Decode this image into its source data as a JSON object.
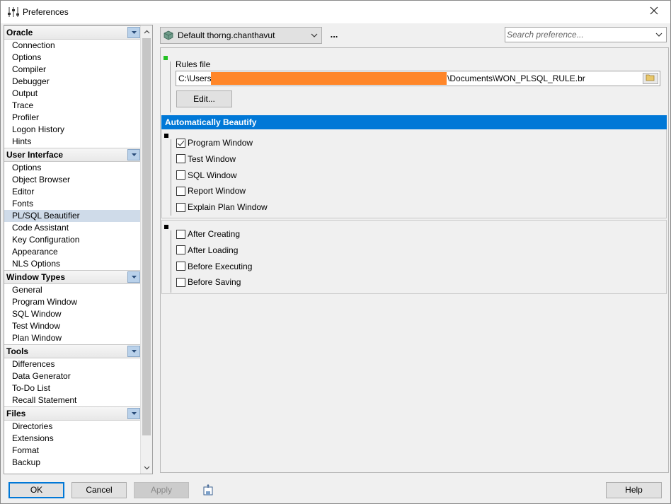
{
  "window": {
    "title": "Preferences"
  },
  "tree": {
    "groups": [
      {
        "label": "Oracle",
        "items": [
          "Connection",
          "Options",
          "Compiler",
          "Debugger",
          "Output",
          "Trace",
          "Profiler",
          "Logon History",
          "Hints"
        ]
      },
      {
        "label": "User Interface",
        "items": [
          "Options",
          "Object Browser",
          "Editor",
          "Fonts",
          "PL/SQL Beautifier",
          "Code Assistant",
          "Key Configuration",
          "Appearance",
          "NLS Options"
        ]
      },
      {
        "label": "Window Types",
        "items": [
          "General",
          "Program Window",
          "SQL Window",
          "Test Window",
          "Plan Window"
        ]
      },
      {
        "label": "Tools",
        "items": [
          "Differences",
          "Data Generator",
          "To-Do List",
          "Recall Statement"
        ]
      },
      {
        "label": "Files",
        "items": [
          "Directories",
          "Extensions",
          "Format",
          "Backup"
        ]
      }
    ],
    "selected": "PL/SQL Beautifier"
  },
  "toolbar": {
    "profile": "Default thorng.chanthavut",
    "more_label": "...",
    "search_placeholder": "Search preference..."
  },
  "rules": {
    "label": "Rules file",
    "path_prefix": "C:\\Users\\",
    "path_suffix": "\\Documents\\WON_PLSQL_RULE.br",
    "edit_label": "Edit..."
  },
  "beautify": {
    "header": "Automatically Beautify",
    "windows": [
      {
        "label": "Program Window",
        "checked": true
      },
      {
        "label": "Test Window",
        "checked": false
      },
      {
        "label": "SQL Window",
        "checked": false
      },
      {
        "label": "Report Window",
        "checked": false
      },
      {
        "label": "Explain Plan Window",
        "checked": false
      }
    ],
    "events": [
      {
        "label": "After Creating",
        "checked": false
      },
      {
        "label": "After Loading",
        "checked": false
      },
      {
        "label": "Before Executing",
        "checked": false
      },
      {
        "label": "Before Saving",
        "checked": false
      }
    ]
  },
  "buttons": {
    "ok": "OK",
    "cancel": "Cancel",
    "apply": "Apply",
    "help": "Help"
  },
  "colors": {
    "accent": "#0078d7",
    "selection": "#cfdbe9",
    "redaction": "#ff8629",
    "marker_green": "#22c022"
  }
}
